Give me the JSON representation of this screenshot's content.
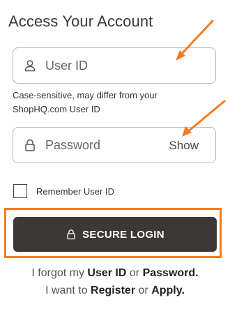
{
  "header": {
    "title": "Access Your Account"
  },
  "user_field": {
    "placeholder": "User ID",
    "value": "",
    "icon": "user-icon"
  },
  "user_hint": "Case-sensitive, may differ from your ShopHQ.com User ID",
  "password_field": {
    "placeholder": "Password",
    "value": "",
    "icon": "lock-icon",
    "toggle_label": "Show"
  },
  "remember": {
    "label": "Remember User ID",
    "checked": false
  },
  "login_button": {
    "label": "SECURE LOGIN",
    "icon": "lock-icon"
  },
  "links": {
    "forgot_prefix": "I forgot my",
    "user_id_link": "User ID",
    "or_1": "or",
    "password_link": "Password.",
    "want_prefix": "I want to",
    "register_link": "Register",
    "or_2": "or",
    "apply_link": "Apply."
  },
  "colors": {
    "accent_highlight": "#f47b20",
    "button_bg": "#3b3838",
    "border": "#b8b8b8"
  }
}
